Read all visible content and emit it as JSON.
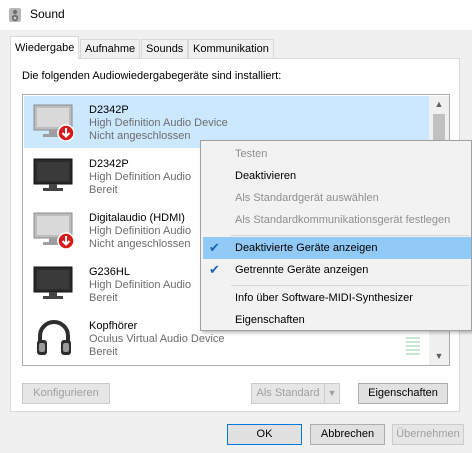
{
  "window": {
    "title": "Sound"
  },
  "tabs": [
    {
      "label": "Wiedergabe"
    },
    {
      "label": "Aufnahme"
    },
    {
      "label": "Sounds"
    },
    {
      "label": "Kommunikation"
    }
  ],
  "panel": {
    "label": "Die folgenden Audiowiedergabegeräte sind installiert:"
  },
  "devices": [
    {
      "name": "D2342P",
      "line1": "High Definition Audio Device",
      "line2": "Nicht angeschlossen",
      "icon": "monitor-disabled-icon"
    },
    {
      "name": "D2342P",
      "line1": "High Definition Audio",
      "line2": "Bereit",
      "icon": "monitor-icon"
    },
    {
      "name": "Digitalaudio (HDMI)",
      "line1": "High Definition Audio",
      "line2": "Nicht angeschlossen",
      "icon": "monitor-disabled-icon"
    },
    {
      "name": "G236HL",
      "line1": "High Definition Audio",
      "line2": "Bereit",
      "icon": "monitor-icon"
    },
    {
      "name": "Kopfhörer",
      "line1": "Oculus Virtual Audio Device",
      "line2": "Bereit",
      "icon": "headphones-icon"
    }
  ],
  "context_menu": {
    "items": [
      {
        "label": "Testen",
        "enabled": false
      },
      {
        "label": "Deaktivieren",
        "enabled": true
      },
      {
        "label": "Als Standardgerät auswählen",
        "enabled": false
      },
      {
        "label": "Als Standardkommunikationsgerät festlegen",
        "enabled": false
      },
      {
        "label": "Deaktivierte Geräte anzeigen",
        "enabled": true,
        "checked": true
      },
      {
        "label": "Getrennte Geräte anzeigen",
        "enabled": true,
        "checked": true
      },
      {
        "label": "Info über Software-MIDI-Synthesizer",
        "enabled": true
      },
      {
        "label": "Eigenschaften",
        "enabled": true
      }
    ]
  },
  "buttons": {
    "configure": "Konfigurieren",
    "set_default": "Als Standard",
    "properties": "Eigenschaften",
    "ok": "OK",
    "cancel": "Abbrechen",
    "apply": "Übernehmen"
  },
  "colors": {
    "selection": "#cce8ff",
    "menu_highlight": "#91c9f7",
    "check": "#1c63b7",
    "red_badge": "#d71a1a"
  }
}
